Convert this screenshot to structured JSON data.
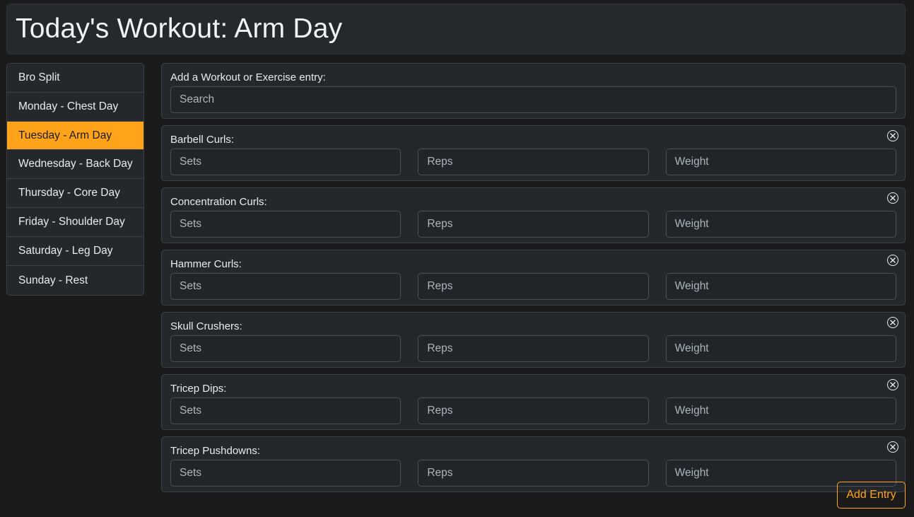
{
  "header": {
    "title": "Today's Workout: Arm Day"
  },
  "sidebar": {
    "items": [
      {
        "label": "Bro Split"
      },
      {
        "label": "Monday - Chest Day"
      },
      {
        "label": "Tuesday - Arm Day",
        "active": true
      },
      {
        "label": "Wednesday - Back Day"
      },
      {
        "label": "Thursday - Core Day"
      },
      {
        "label": "Friday - Shoulder Day"
      },
      {
        "label": "Saturday - Leg Day"
      },
      {
        "label": "Sunday - Rest"
      }
    ]
  },
  "search": {
    "label": "Add a Workout or Exercise entry:",
    "placeholder": "Search"
  },
  "fields": {
    "sets": "Sets",
    "reps": "Reps",
    "weight": "Weight"
  },
  "exercises": [
    {
      "name": "Barbell Curls:"
    },
    {
      "name": "Concentration Curls:"
    },
    {
      "name": "Hammer Curls:"
    },
    {
      "name": "Skull Crushers:"
    },
    {
      "name": "Tricep Dips:"
    },
    {
      "name": "Tricep Pushdowns:"
    }
  ],
  "actions": {
    "add_entry": "Add Entry"
  },
  "icons": {
    "remove": "close-circle-icon"
  },
  "colors": {
    "accent": "#ffa31a",
    "background": "#1b1b1b",
    "panel": "#24282d"
  }
}
